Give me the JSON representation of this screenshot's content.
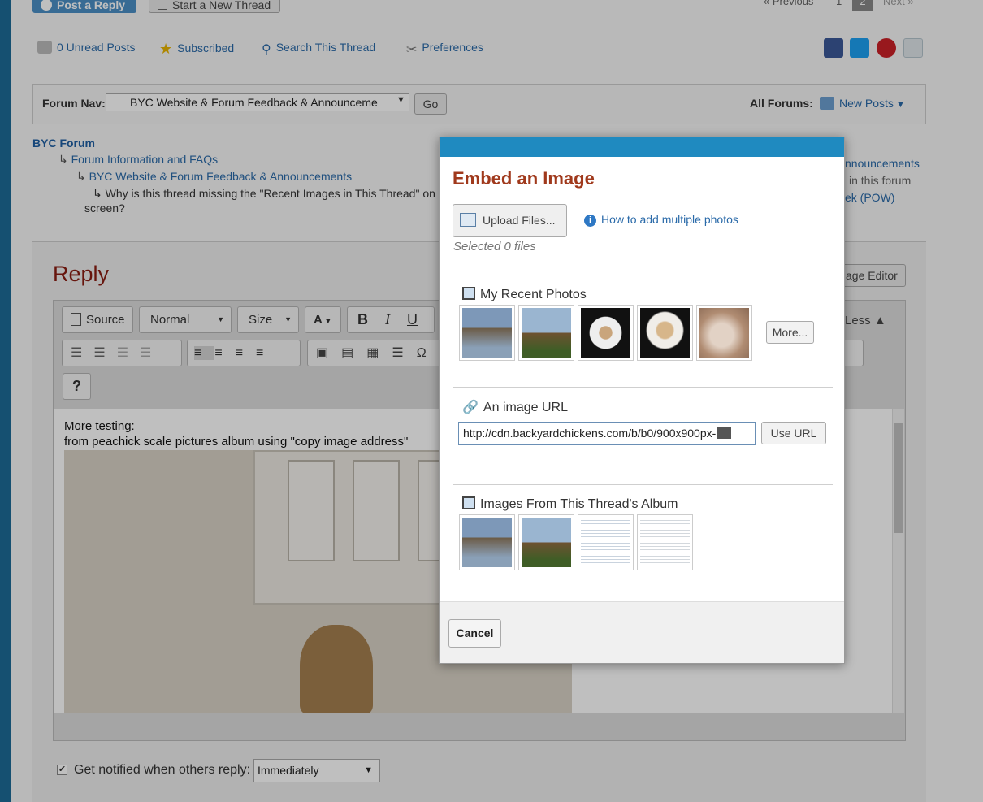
{
  "top": {
    "post_reply": "Post a Reply",
    "start_thread": "Start a New Thread",
    "previous": "« Previous",
    "page1": "1",
    "page2": "2",
    "next": "Next »"
  },
  "tools": {
    "unread": "0 Unread Posts",
    "subscribed": "Subscribed",
    "search": "Search This Thread",
    "preferences": "Preferences"
  },
  "forumnav": {
    "label": "Forum Nav:",
    "selected": "BYC Website & Forum Feedback & Announceme",
    "go": "Go",
    "all_forums": "All Forums:",
    "new_posts": "New Posts"
  },
  "breadcrumb": {
    "root": "BYC Forum",
    "l1": "Forum Information and FAQs",
    "l2": "BYC Website & Forum Feedback & Announcements",
    "l3a": "Why is this thread missing the \"Recent Images in This Thread\" on",
    "l3b": "screen?"
  },
  "right_sidebar": {
    "line1": "nnouncements",
    "line2": "in this forum",
    "line3": "ek (POW)"
  },
  "reply": {
    "title": "Reply",
    "image_editor": "age Editor",
    "less": "Less",
    "source": "Source",
    "format": "Normal",
    "size": "Size",
    "content_line1": "More testing:",
    "content_line2": "from peachick scale pictures album using \"copy image address\"",
    "notify_label": "Get notified when others reply:",
    "notify_value": "Immediately"
  },
  "modal": {
    "title": "Embed an Image",
    "upload": "Upload Files...",
    "how_to": "How to add multiple photos",
    "selected": "Selected 0 files",
    "recent_title": "My Recent Photos",
    "more": "More...",
    "url_title": "An image URL",
    "url_value": "http://cdn.backyardchickens.com/b/b0/900x900px-",
    "use_url": "Use URL",
    "album_title": "Images From This Thread's Album",
    "cancel": "Cancel"
  }
}
